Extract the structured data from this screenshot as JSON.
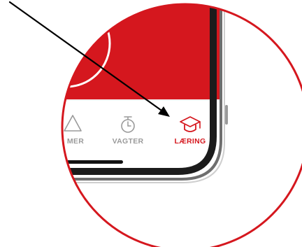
{
  "tab_bar": {
    "items": [
      {
        "label": "MER",
        "icon": "warning-triangle-icon",
        "active": false
      },
      {
        "label": "VAGTER",
        "icon": "stopwatch-icon",
        "active": false
      },
      {
        "label": "LÆRING",
        "icon": "graduation-cap-icon",
        "active": true
      }
    ]
  },
  "colors": {
    "accent": "#d5171e",
    "inactive": "#9a9a9a",
    "phone_frame": "#1b1b1b",
    "annotation_arrow": "#000000",
    "background": "#ffffff"
  }
}
